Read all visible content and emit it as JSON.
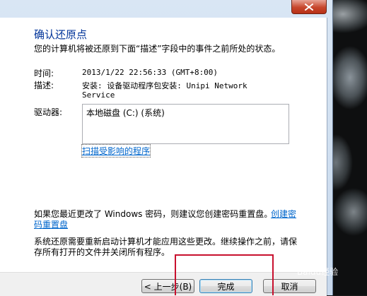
{
  "dialog": {
    "title": "确认还原点",
    "subtitle": "您的计算机将被还原到下面“描述”字段中的事件之前所处的状态。"
  },
  "details": {
    "time_label": "时间:",
    "time_value": "2013/1/22 22:56:33 (GMT+8:00)",
    "desc_label": "描述:",
    "desc_value_line1": "安装: 设备驱动程序包安装: Unipi Network",
    "desc_value_line2": "Service",
    "drives_label": "驱动器:",
    "drives": [
      "本地磁盘 (C:) (系统)"
    ]
  },
  "links": {
    "scan_affected": "扫描受影响的程序",
    "create_reset_disk_part1": "创建密",
    "create_reset_disk_part2": "码重置盘"
  },
  "notes": {
    "password_line1": "如果您最近更改了 Windows 密码，则建议您创建密码重置盘。",
    "restart_line1": "系统还原需要重新启动计算机才能应用这些更改。继续操作之前，请保",
    "restart_line2": "存所有打开的文件并关闭所有程序。"
  },
  "buttons": {
    "back": "< 上一步(B)",
    "finish": "完成",
    "cancel": "取消"
  },
  "watermark": {
    "text": "Baidu经验"
  },
  "icons": [
    "close-icon"
  ],
  "colors": {
    "title": "#003399",
    "link": "#0066cc",
    "annotation": "#c8102e"
  }
}
